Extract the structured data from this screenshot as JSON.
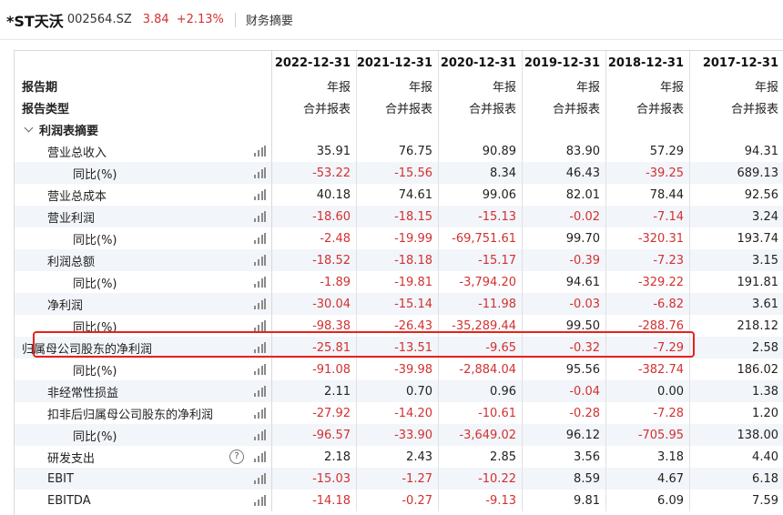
{
  "header": {
    "name": "*ST天沃",
    "code": "002564.SZ",
    "price": "3.84",
    "change": "+2.13%",
    "tab": "财务摘要"
  },
  "columns": [
    "2022-12-31",
    "2021-12-31",
    "2020-12-31",
    "2019-12-31",
    "2018-12-31",
    "2017-12-31"
  ],
  "report_period_label": "报告期",
  "report_type_label": "报告类型",
  "report_period_values": [
    "年报",
    "年报",
    "年报",
    "年报",
    "年报",
    "年报"
  ],
  "report_type_values": [
    "合并报表",
    "合并报表",
    "合并报表",
    "合并报表",
    "合并报表",
    "合并报表"
  ],
  "section_title": "利润表摘要",
  "rows": [
    {
      "label": "营业总收入",
      "values": [
        "35.91",
        "76.75",
        "90.89",
        "83.90",
        "57.29",
        "94.31"
      ]
    },
    {
      "label": "同比(%)",
      "values": [
        "-53.22",
        "-15.56",
        "8.34",
        "46.43",
        "-39.25",
        "689.13"
      ]
    },
    {
      "label": "营业总成本",
      "values": [
        "40.18",
        "74.61",
        "99.06",
        "82.01",
        "78.44",
        "92.56"
      ]
    },
    {
      "label": "营业利润",
      "values": [
        "-18.60",
        "-18.15",
        "-15.13",
        "-0.02",
        "-7.14",
        "3.24"
      ]
    },
    {
      "label": "同比(%)",
      "values": [
        "-2.48",
        "-19.99",
        "-69,751.61",
        "99.70",
        "-320.31",
        "193.74"
      ]
    },
    {
      "label": "利润总额",
      "values": [
        "-18.52",
        "-18.18",
        "-15.17",
        "-0.39",
        "-7.23",
        "3.15"
      ]
    },
    {
      "label": "同比(%)",
      "values": [
        "-1.89",
        "-19.81",
        "-3,794.20",
        "94.61",
        "-329.22",
        "191.81"
      ]
    },
    {
      "label": "净利润",
      "values": [
        "-30.04",
        "-15.14",
        "-11.98",
        "-0.03",
        "-6.82",
        "3.61"
      ]
    },
    {
      "label": "同比(%)",
      "values": [
        "-98.38",
        "-26.43",
        "-35,289.44",
        "99.50",
        "-288.76",
        "218.12"
      ]
    },
    {
      "label": "归属母公司股东的净利润",
      "values": [
        "-25.81",
        "-13.51",
        "-9.65",
        "-0.32",
        "-7.29",
        "2.58"
      ]
    },
    {
      "label": "同比(%)",
      "values": [
        "-91.08",
        "-39.98",
        "-2,884.04",
        "95.56",
        "-382.74",
        "186.02"
      ]
    },
    {
      "label": "非经常性损益",
      "values": [
        "2.11",
        "0.70",
        "0.96",
        "-0.04",
        "0.00",
        "1.38"
      ]
    },
    {
      "label": "扣非后归属母公司股东的净利润",
      "values": [
        "-27.92",
        "-14.20",
        "-10.61",
        "-0.28",
        "-7.28",
        "1.20"
      ]
    },
    {
      "label": "同比(%)",
      "values": [
        "-96.57",
        "-33.90",
        "-3,649.02",
        "96.12",
        "-705.95",
        "138.00"
      ]
    },
    {
      "label": "研发支出",
      "values": [
        "2.18",
        "2.43",
        "2.85",
        "3.56",
        "3.18",
        "4.40"
      ]
    },
    {
      "label": "EBIT",
      "values": [
        "-15.03",
        "-1.27",
        "-10.22",
        "8.59",
        "4.67",
        "6.18"
      ]
    },
    {
      "label": "EBITDA",
      "values": [
        "-14.18",
        "-0.27",
        "-9.13",
        "9.81",
        "6.09",
        "7.59"
      ]
    }
  ],
  "colors": {
    "negative": "#d23131",
    "positive": "#222222",
    "highlight": "#e8211c",
    "row_alt": "#f2f5f9"
  },
  "icons": {
    "bar": "bar-chart-icon",
    "help": "question-circle-icon",
    "chevron": "chevron-down-icon"
  },
  "help_glyph": "?"
}
